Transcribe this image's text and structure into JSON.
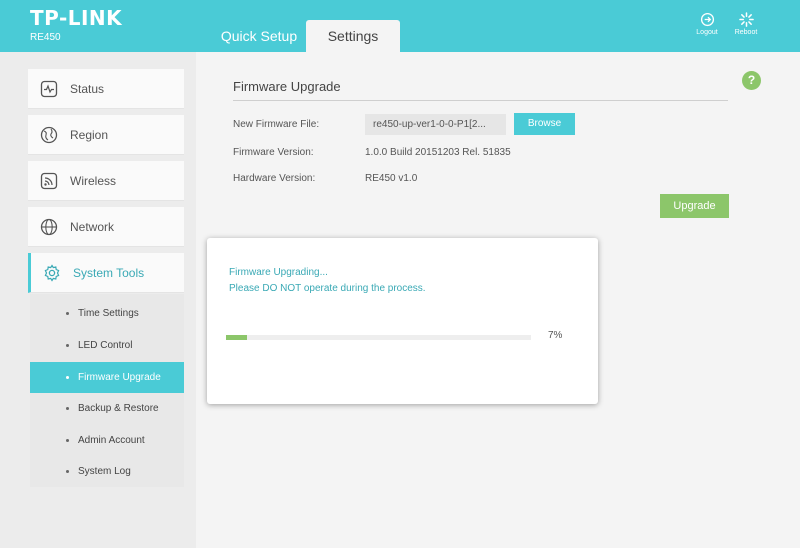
{
  "brand": {
    "logo": "TP-LINK",
    "model": "RE450"
  },
  "nav": {
    "quick_setup": "Quick Setup",
    "settings": "Settings"
  },
  "header_actions": {
    "logout": "Logout",
    "reboot": "Reboot"
  },
  "sidebar": {
    "items": [
      {
        "label": "Status",
        "icon": "status-icon"
      },
      {
        "label": "Region",
        "icon": "globe-icon"
      },
      {
        "label": "Wireless",
        "icon": "wireless-icon"
      },
      {
        "label": "Network",
        "icon": "network-icon"
      },
      {
        "label": "System Tools",
        "icon": "gear-icon",
        "active": true
      }
    ],
    "sub_items": [
      {
        "label": "Time Settings"
      },
      {
        "label": "LED Control"
      },
      {
        "label": "Firmware Upgrade",
        "active": true
      },
      {
        "label": "Backup & Restore"
      },
      {
        "label": "Admin Account"
      },
      {
        "label": "System Log"
      }
    ]
  },
  "firmware": {
    "title": "Firmware Upgrade",
    "new_file_label": "New Firmware File:",
    "new_file_value": "re450-up-ver1-0-0-P1[2...",
    "browse": "Browse",
    "version_label": "Firmware Version:",
    "version_value": "1.0.0 Build 20151203 Rel. 51835",
    "hardware_label": "Hardware Version:",
    "hardware_value": "RE450 v1.0",
    "upgrade": "Upgrade",
    "help": "?"
  },
  "modal": {
    "line1": "Firmware Upgrading...",
    "line2": "Please DO NOT operate during the process.",
    "progress_percent": 7,
    "progress_text": "7%"
  },
  "colors": {
    "accent": "#4acbd6",
    "green": "#8cc66a"
  }
}
